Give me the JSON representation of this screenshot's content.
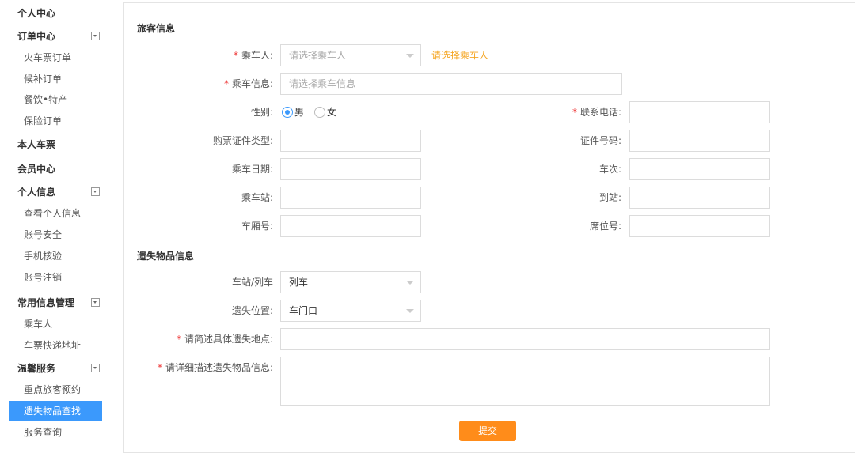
{
  "sidebar": {
    "items": [
      {
        "label": "个人中心",
        "type": "grp"
      },
      {
        "label": "订单中心",
        "type": "grp",
        "toggle": true
      },
      {
        "label": "火车票订单",
        "type": "sub"
      },
      {
        "label": "候补订单",
        "type": "sub"
      },
      {
        "label": "餐饮•特产",
        "type": "sub"
      },
      {
        "label": "保险订单",
        "type": "sub"
      },
      {
        "label": "本人车票",
        "type": "grp"
      },
      {
        "label": "会员中心",
        "type": "grp"
      },
      {
        "label": "个人信息",
        "type": "grp",
        "toggle": true
      },
      {
        "label": "查看个人信息",
        "type": "sub"
      },
      {
        "label": "账号安全",
        "type": "sub"
      },
      {
        "label": "手机核验",
        "type": "sub"
      },
      {
        "label": "账号注销",
        "type": "sub"
      },
      {
        "label": "常用信息管理",
        "type": "grp",
        "toggle": true
      },
      {
        "label": "乘车人",
        "type": "sub"
      },
      {
        "label": "车票快递地址",
        "type": "sub"
      },
      {
        "label": "温馨服务",
        "type": "grp",
        "toggle": true
      },
      {
        "label": "重点旅客预约",
        "type": "sub"
      },
      {
        "label": "遗失物品查找",
        "type": "sub",
        "active": true
      },
      {
        "label": "服务查询",
        "type": "sub"
      }
    ]
  },
  "form": {
    "section1": "旅客信息",
    "passenger_label": "乘车人:",
    "passenger_placeholder": "请选择乘车人",
    "passenger_hint": "请选择乘车人",
    "info_label": "乘车信息:",
    "info_placeholder": "请选择乘车信息",
    "gender_label": "性别:",
    "male": "男",
    "female": "女",
    "phone_label": "联系电话:",
    "idtype_label": "购票证件类型:",
    "idno_label": "证件号码:",
    "date_label": "乘车日期:",
    "train_label": "车次:",
    "from_label": "乘车站:",
    "to_label": "到站:",
    "coach_label": "车厢号:",
    "seat_label": "席位号:",
    "section2": "遗失物品信息",
    "place_label": "车站/列车",
    "place_value": "列车",
    "loc_label": "遗失位置:",
    "loc_value": "车门口",
    "brief_label": "请简述具体遗失地点:",
    "detail_label": "请详细描述遗失物品信息:",
    "required_mark": "*",
    "submit": "提交"
  }
}
